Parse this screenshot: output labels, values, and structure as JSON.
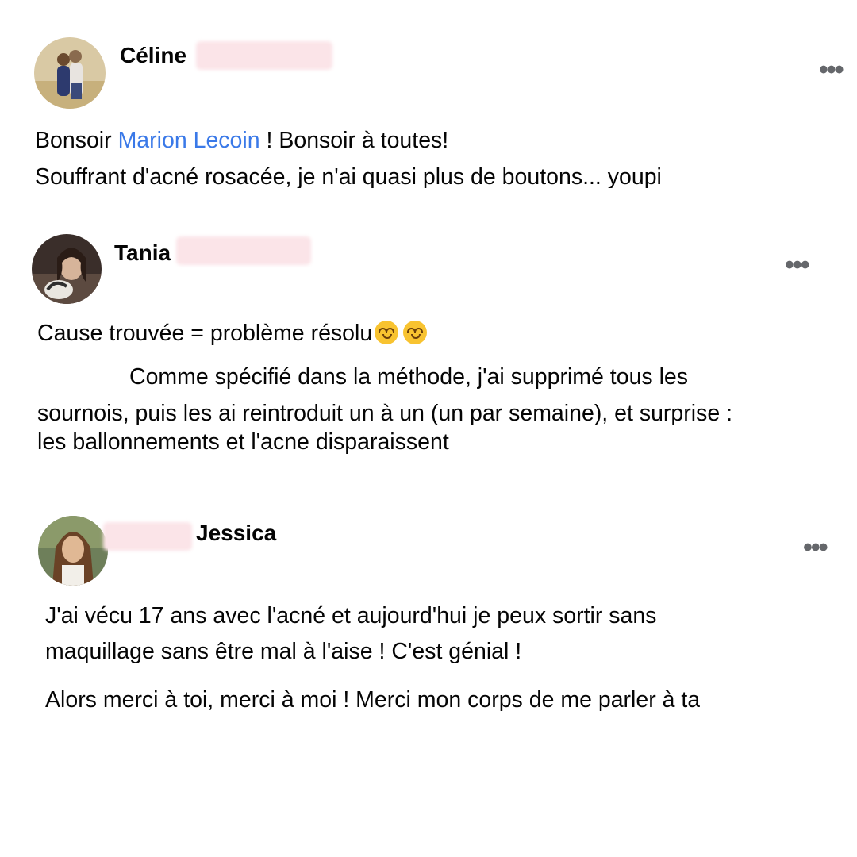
{
  "posts": [
    {
      "author": "Céline",
      "more_label": "•••",
      "line1_before": "Bonsoir ",
      "line1_mention": "Marion Lecoin",
      "line1_after": " ! Bonsoir à toutes!",
      "line2": "Souffrant d'acné rosacée, je n'ai quasi plus de boutons... youpi"
    },
    {
      "author": "Tania",
      "more_label": "•••",
      "line1": "Cause trouvée = problème résolu",
      "emoji": "upside-down-face-emoji",
      "line2": "Comme spécifié dans la méthode, j'ai supprimé tous les",
      "line3": "sournois, puis les ai reintroduit un à un (un par semaine), et surprise :",
      "line4": "les ballonnements et l'acne disparaissent"
    },
    {
      "author": "Jessica",
      "more_label": "•••",
      "line1": "J'ai vécu 17 ans avec l'acné et aujourd'hui je peux sortir sans",
      "line2": "maquillage sans être mal à l'aise ! C'est génial !",
      "line3": "Alors merci à toi, merci à moi ! Merci mon corps de me parler à ta"
    }
  ],
  "colors": {
    "mention": "#3a79e8",
    "redaction": "#fbe4e8",
    "more_icon": "#65676b"
  }
}
